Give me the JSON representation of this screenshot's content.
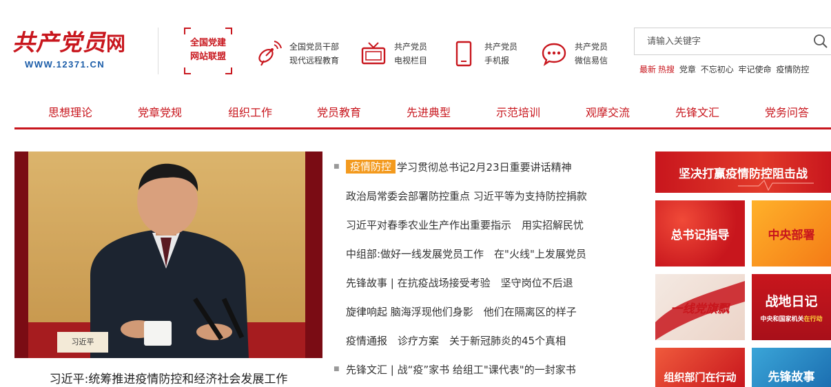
{
  "header": {
    "logo": {
      "calligraphy": "共产党员",
      "wang": "网",
      "url": "WWW.12371.CN"
    },
    "alliance": {
      "line1": "全国党建",
      "line2": "网站联盟"
    },
    "services": [
      {
        "icon": "satellite-dish-icon",
        "line1": "全国党员干部",
        "line2": "现代远程教育"
      },
      {
        "icon": "tv-icon",
        "line1": "共产党员",
        "line2": "电视栏目"
      },
      {
        "icon": "mobile-phone-icon",
        "line1": "共产党员",
        "line2": "手机报"
      },
      {
        "icon": "chat-bubble-icon",
        "line1": "共产党员",
        "line2": "微信易信"
      }
    ],
    "search": {
      "placeholder": "请输入关键字",
      "value": ""
    },
    "hot": {
      "label1": "最新",
      "label2": "热搜",
      "words": [
        "党章",
        "不忘初心",
        "牢记使命",
        "疫情防控"
      ]
    }
  },
  "nav": [
    "思想理论",
    "党章党规",
    "组织工作",
    "党员教育",
    "先进典型",
    "示范培训",
    "观摩交流",
    "先锋文汇",
    "党务问答"
  ],
  "hero": {
    "nameplate": "习近平",
    "caption": "习近平:统筹推进疫情防控和经济社会发展工作"
  },
  "news": {
    "tag": "疫情防控",
    "items": [
      "学习贯彻总书记2月23日重要讲话精神",
      "政治局常委会部署防控重点 习近平等为支持防控捐款",
      "习近平对春季农业生产作出重要指示　用实招解民忧",
      "中组部:做好一线发展党员工作　在\"火线\"上发展党员",
      "先锋故事 | 在抗疫战场接受考验　坚守岗位不后退",
      "旋律响起 脑海浮现他们身影　他们在隔离区的样子",
      "疫情通报　诊疗方案　关于新冠肺炎的45个真相",
      "先锋文汇 | 战“疫”家书 给组工\"课代表\"的一封家书"
    ]
  },
  "banners": {
    "top": "坚决打赢疫情防控阻击战",
    "b1": "总书记指导",
    "b2": "中央部署",
    "b3": "一线党旗飘",
    "b4": "战地日记",
    "b4_sub1": "中央和国家机关",
    "b4_sub2": "在行动",
    "b5": "组织部门在行动",
    "b6": "先锋故事"
  },
  "colors": {
    "brand_red": "#c8161d",
    "tag_orange": "#f39a1e",
    "logo_blue": "#1a5ca8"
  }
}
